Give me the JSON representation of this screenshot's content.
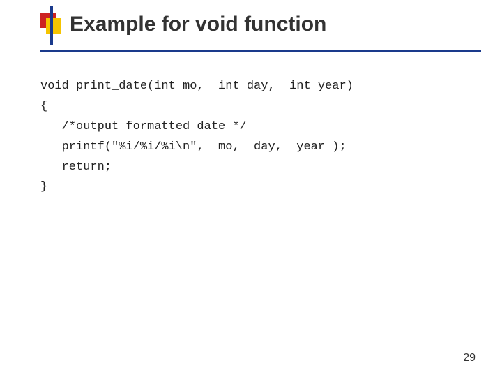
{
  "slide": {
    "title": "Example for void function",
    "accent": {
      "red": "#cc2222",
      "yellow": "#f5c400",
      "blue": "#1a3a8c"
    },
    "code": {
      "lines": [
        "void print_date(int mo,  int day,  int year)",
        "{",
        "   /*output formatted date */",
        "   printf(\"%i/%i/%i\\n\",  mo,  day,  year );",
        "   return;",
        "}"
      ]
    },
    "page_number": "29"
  }
}
